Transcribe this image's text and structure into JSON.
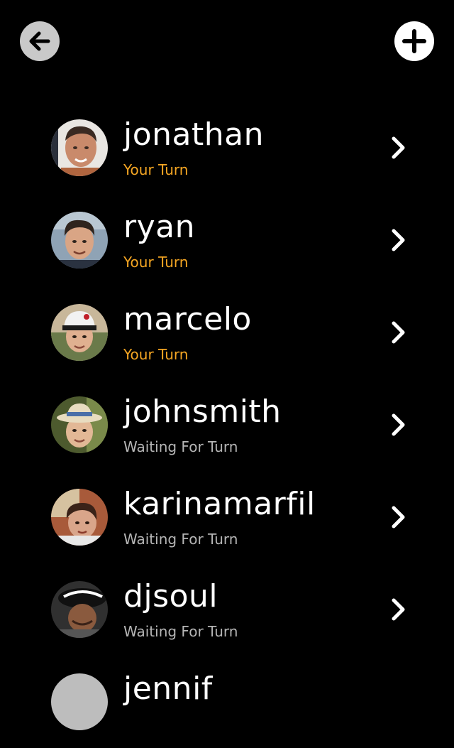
{
  "header": {
    "back_icon": "arrow-left-icon",
    "add_icon": "plus-icon"
  },
  "games": [
    {
      "name": "jonathan",
      "status": "Your Turn",
      "state": "your-turn"
    },
    {
      "name": "ryan",
      "status": "Your Turn",
      "state": "your-turn"
    },
    {
      "name": "marcelo",
      "status": "Your Turn",
      "state": "your-turn"
    },
    {
      "name": "johnsmith",
      "status": "Waiting For Turn",
      "state": "waiting"
    },
    {
      "name": "karinamarfil",
      "status": "Waiting For Turn",
      "state": "waiting"
    },
    {
      "name": "djsoul",
      "status": "Waiting For Turn",
      "state": "waiting"
    },
    {
      "name": "jennif",
      "status": "",
      "state": "waiting"
    }
  ],
  "colors": {
    "background": "#000000",
    "your_turn": "#f5a623",
    "waiting": "#b5b5b5",
    "back_button": "#c9c9c9",
    "add_button": "#ffffff"
  }
}
